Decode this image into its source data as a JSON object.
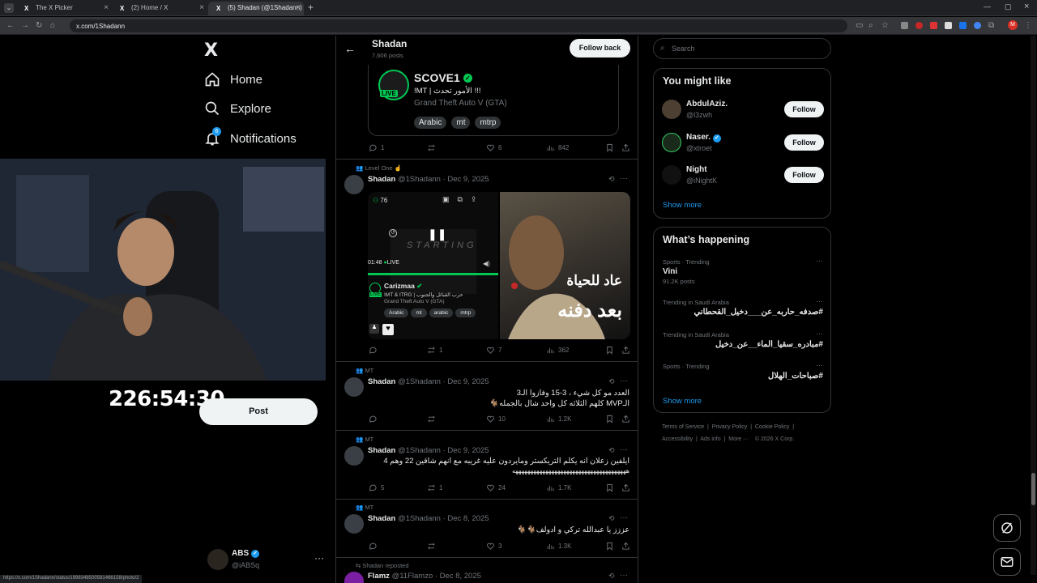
{
  "browser": {
    "tabs": [
      {
        "title": "The X Picker"
      },
      {
        "title": "(2) Home / X"
      },
      {
        "title": "(5) Shadan (@1Shadann) / X"
      }
    ],
    "url": "x.com/1Shadann",
    "status_url": "https://x.com/1Shadann/status/1998348500581466158/photo/2",
    "profile_initial": "M"
  },
  "nav": {
    "logo": "X",
    "items": [
      {
        "label": "Home"
      },
      {
        "label": "Explore"
      },
      {
        "label": "Notifications",
        "badge": "6"
      }
    ],
    "post_label": "Post",
    "timer": "226:54:30",
    "account": {
      "name": "ABS",
      "handle": "@iABSq"
    }
  },
  "profile_header": {
    "name": "Shadan",
    "posts": "7,606 posts",
    "follow_back": "Follow back"
  },
  "stream_card": {
    "name": "SCOVE1",
    "live": "LIVE",
    "title": "!MT | الأمور تحدث !!!",
    "game": "Grand Theft Auto V (GTA)",
    "tags": [
      "Arabic",
      "mt",
      "mtrp"
    ]
  },
  "tweets": [
    {
      "context": "",
      "stats": {
        "replies": "1",
        "reposts": "",
        "likes": "6",
        "views": "842"
      }
    },
    {
      "context": "Level One ☝️",
      "name": "Shadan",
      "handle": "@1Shadann · Dec 9, 2025",
      "media": {
        "viewers": "76",
        "starting": "STARTING",
        "time": "01:48",
        "live": "LIVE",
        "streamer": "Carizmaa",
        "line1": "!MT & ITRG | حرب القبائل والجنوب",
        "line2": "Grand Theft Auto V (GTA)",
        "tags": [
          "Arabic",
          "mt",
          "arabic",
          "mtrp"
        ],
        "caption1": "عاد للحياة",
        "caption2": "بعد دفنه"
      },
      "stats": {
        "replies": "",
        "reposts": "1",
        "likes": "7",
        "views": "362"
      }
    },
    {
      "context": "MT",
      "name": "Shadan",
      "handle": "@1Shadann · Dec 9, 2025",
      "line1": "العدد مو كل شيء ، 3-15 وفازوا الـ3",
      "line2": "الـMVP كلهم الثلاثه كل واحد شال بالجمله🐐",
      "stats": {
        "replies": "",
        "reposts": "",
        "likes": "10",
        "views": "1.2K"
      }
    },
    {
      "context": "MT",
      "name": "Shadan",
      "handle": "@1Shadann · Dec 9, 2025",
      "line1": "ايلفين زعلان انه يكلم التريكستر ومايردون عليه غريبه مع انهم شاقين 22 وهم 4",
      "line2": "ههههههههههههههههههههههههههههههههههههههه",
      "stats": {
        "replies": "5",
        "reposts": "1",
        "likes": "24",
        "views": "1.7K"
      }
    },
    {
      "context": "MT",
      "name": "Shadan",
      "handle": "@1Shadann · Dec 8, 2025",
      "line1": "عززز يا عبدالله تركي و ادولف🐐🐐",
      "stats": {
        "replies": "",
        "reposts": "",
        "likes": "3",
        "views": "1.3K"
      }
    },
    {
      "context": "Shadan reposted",
      "name": "Flamz",
      "handle": "@11Flamzo · Dec 8, 2025"
    }
  ],
  "sidebar": {
    "search_placeholder": "Search",
    "you_might_like": {
      "title": "You might like",
      "users": [
        {
          "name": "AbdulAziz.",
          "handle": "@l3zwh",
          "button": "Follow"
        },
        {
          "name": "Naser.",
          "handle": "@xtroet",
          "button": "Follow"
        },
        {
          "name": "Night",
          "handle": "@iNightK",
          "button": "Follow"
        }
      ],
      "show_more": "Show more"
    },
    "whats_happening": {
      "title": "What’s happening",
      "trends": [
        {
          "category": "Sports · Trending",
          "title": "Vini",
          "posts": "91.2K posts"
        },
        {
          "category": "Trending in Saudi Arabia",
          "title": "#صدفه_حاربه_عن___دخيل_القحطاني",
          "posts": ""
        },
        {
          "category": "Trending in Saudi Arabia",
          "title": "#مبادره_سقيا_الماء__عن_دخيل",
          "posts": ""
        },
        {
          "category": "Sports · Trending",
          "title": "#صباحات_الهلال",
          "posts": ""
        }
      ],
      "show_more": "Show more"
    },
    "footer": {
      "line1": [
        "Terms of Service",
        "Privacy Policy",
        "Cookie Policy"
      ],
      "line2": [
        "Accessibility",
        "Ads info",
        "More ···",
        "© 2026 X Corp."
      ]
    }
  },
  "colors": {
    "accent": "#1d9bf0",
    "live_green": "#00c853",
    "background": "#000000",
    "border": "#2f3336"
  }
}
